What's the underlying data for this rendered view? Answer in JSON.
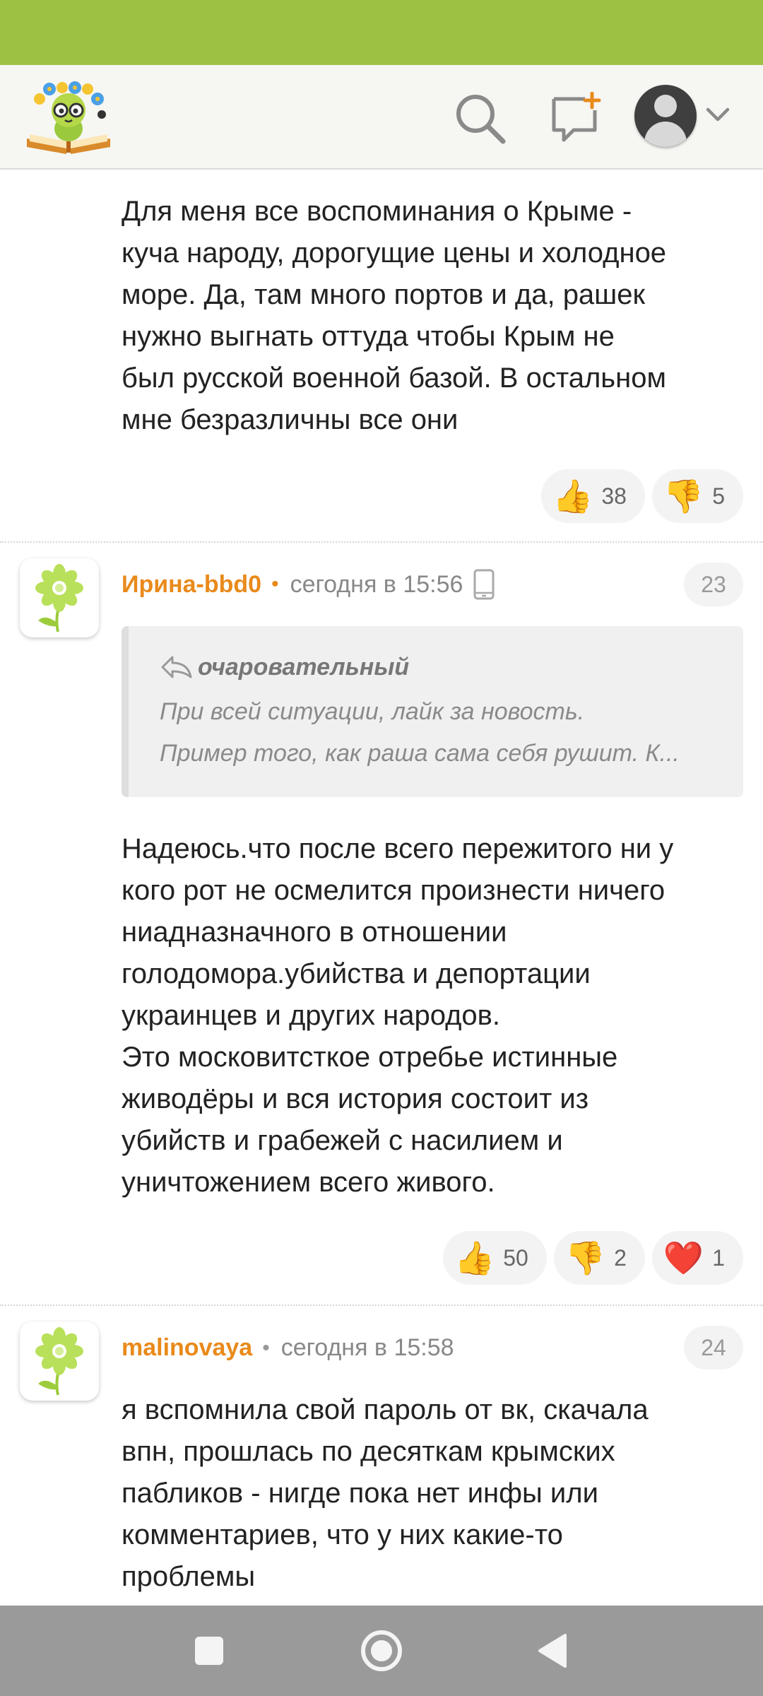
{
  "colors": {
    "statusbar": "#9dc243",
    "accent": "#e98a1b",
    "navbar": "#9a9a9a"
  },
  "header": {
    "logo": "site-logo-book-with-flowers",
    "icons": [
      "search-icon",
      "new-message-icon",
      "user-avatar-icon",
      "chevron-down-icon"
    ]
  },
  "comments": [
    {
      "text": "Для меня все воспоминания о Крыме -\nкуча народу, дорогущие цены и холодное\nморе. Да, там много портов и да, рашек\nнужно выгнать оттуда чтобы Крым не\nбыл русской военной базой. В остальном\nмне безразличны все они",
      "reactions": [
        {
          "emoji": "👍",
          "icon": "thumbs-up-icon",
          "count": "38"
        },
        {
          "emoji": "👎",
          "icon": "thumbs-down-icon",
          "count": "5"
        }
      ]
    },
    {
      "author": "Ирина-bbd0",
      "time": "сегодня в 15:56",
      "number": "23",
      "quote": {
        "author": "очаровательный",
        "line1": "При всей ситуации, лайк за новость.",
        "line2": "Пример того, как раша сама себя рушит. К..."
      },
      "text": "Надеюсь.что после всего пережитого ни у\nкого рот не осмелится произнести ничего\nниадназначного в отношении\nголодомора.убийства и депортации\nукраинцев и других народов.\nЭто московитсткое отребье истинные\nживодёры и вся история состоит из\nубийств и грабежей с насилием и\nуничтожением всего живого.",
      "reactions": [
        {
          "emoji": "👍",
          "icon": "thumbs-up-icon",
          "count": "50"
        },
        {
          "emoji": "👎",
          "icon": "thumbs-down-icon",
          "count": "2"
        },
        {
          "emoji": "❤️",
          "icon": "heart-icon",
          "count": "1"
        }
      ]
    },
    {
      "author": "malinovaya",
      "time": "сегодня в 15:58",
      "number": "24",
      "text": "я вспомнила свой пароль от вк, скачала\nвпн, прошлась по десяткам крымских\nпабликов - нигде пока нет инфы или\nкомментариев, что у них какие-то\nпроблемы"
    }
  ],
  "navbar": [
    "recents-square-icon",
    "home-circle-icon",
    "back-triangle-icon"
  ]
}
